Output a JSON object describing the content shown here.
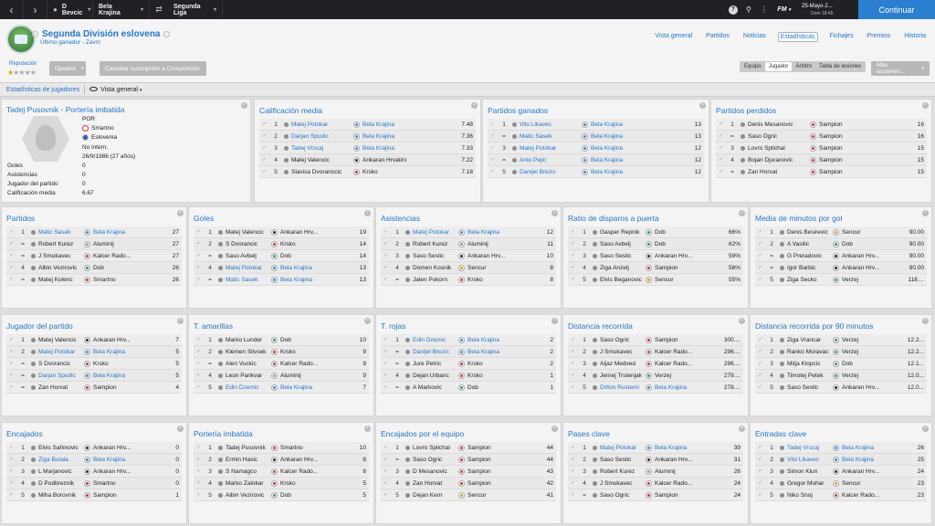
{
  "topbar": {
    "crumbs": [
      "D Bevcic",
      "Bela Krajina",
      "Segunda Liga"
    ],
    "fm_label": "FM",
    "date": "25-Mayo-2...",
    "time": "Dom 18:45",
    "continue_label": "Continuar"
  },
  "header": {
    "title": "Segunda División eslovena",
    "subtitle": "Último ganador - Zavrc",
    "tabs": [
      "Vista general",
      "Partidos",
      "Noticias",
      "Estadísticas",
      "Fichajes",
      "Premios",
      "Historia"
    ],
    "subtabs": [
      "Equipo",
      "Jugador",
      "Árbitro",
      "Tabla de lesiones"
    ],
    "reputation_label": "Reputación",
    "reputation_stars": 1,
    "scout_label": "Ojeador",
    "cancel_label": "Cancelar suscripción a Competición",
    "more_label": "Más acciones..."
  },
  "filter": {
    "link": "Estadísticas de jugadores",
    "view": "Vista general"
  },
  "player": {
    "title": "Tadej Pusovnik - Portería imbatida",
    "position": "POR",
    "club": "Smartno",
    "nation": "Eslovenia",
    "intl": "No intern.",
    "dob": "26/9/1986 (27 años)",
    "stats": [
      {
        "label": "Goles",
        "value": "0"
      },
      {
        "label": "Asistencias",
        "value": "0"
      },
      {
        "label": "Jugador del partido",
        "value": "0"
      },
      {
        "label": "Calificación media",
        "value": "6.67"
      }
    ]
  },
  "colors": {
    "accent": "#2577c8",
    "topbar": "#1f2124",
    "continue": "#2a7fd1"
  },
  "panels": [
    {
      "title": "Calificación media",
      "rows": [
        [
          "1",
          "Matej Potokar",
          "Bela Krajina",
          "7.48"
        ],
        [
          "2",
          "Darjan Spudic",
          "Bela Krajina",
          "7.36"
        ],
        [
          "3",
          "Tadej Vrscaj",
          "Bela Krajina",
          "7.33"
        ],
        [
          "4",
          "Matej Valencic",
          "Ankaran Hrvatini",
          "7.22"
        ],
        [
          "5",
          "Slavisa Dvoranocic",
          "Krsko",
          "7.18"
        ]
      ]
    },
    {
      "title": "Partidos ganados",
      "rows": [
        [
          "1",
          "Vito Likavec",
          "Bela Krajina",
          "13"
        ],
        [
          "=",
          "Matic Sasek",
          "Bela Krajina",
          "13"
        ],
        [
          "3",
          "Matej Potokar",
          "Bela Krajina",
          "12"
        ],
        [
          "=",
          "Anto Pejic",
          "Bela Krajina",
          "12"
        ],
        [
          "5",
          "Danijel Brezic",
          "Bela Krajina",
          "12"
        ]
      ]
    },
    {
      "title": "Partidos perdidos",
      "rows": [
        [
          "1",
          "Denis Mesanovic",
          "Sampion",
          "16"
        ],
        [
          "=",
          "Saso Ogric",
          "Sampion",
          "16"
        ],
        [
          "3",
          "Lovro Splichal",
          "Sampion",
          "15"
        ],
        [
          "4",
          "Bojan Djuranovic",
          "Sampion",
          "15"
        ],
        [
          "=",
          "Zan Horvat",
          "Sampion",
          "15"
        ]
      ]
    },
    {
      "title": "Partidos",
      "rows": [
        [
          "1",
          "Matic Sasek",
          "Bela Krajina",
          "27"
        ],
        [
          "=",
          "Robert Kurez",
          "Aluminij",
          "27"
        ],
        [
          "=",
          "J Smukavec",
          "Kalcer Rado...",
          "27"
        ],
        [
          "4",
          "Albin Vezirovic",
          "Dob",
          "26"
        ],
        [
          "=",
          "Matej Kolenc",
          "Smartno",
          "26"
        ]
      ]
    },
    {
      "title": "Goles",
      "rows": [
        [
          "1",
          "Matej Valencic",
          "Ankaran Hrv...",
          "19"
        ],
        [
          "2",
          "S Dvorancic",
          "Krsko",
          "14"
        ],
        [
          "=",
          "Saso Avbelj",
          "Dob",
          "14"
        ],
        [
          "4",
          "Matej Potokar",
          "Bela Krajina",
          "13"
        ],
        [
          "=",
          "Matic Sasek",
          "Bela Krajina",
          "13"
        ]
      ]
    },
    {
      "title": "Asistencias",
      "rows": [
        [
          "1",
          "Matej Potokar",
          "Bela Krajina",
          "12"
        ],
        [
          "2",
          "Robert Kurez",
          "Aluminij",
          "11"
        ],
        [
          "3",
          "Saso Sestic",
          "Ankaran Hrv...",
          "10"
        ],
        [
          "4",
          "Domen Kosnik",
          "Sencur",
          "8"
        ],
        [
          "=",
          "Jalen Pokorn",
          "Krsko",
          "8"
        ]
      ]
    },
    {
      "title": "Ratio de disparos a puerta",
      "rows": [
        [
          "1",
          "Gasper Repnik",
          "Dob",
          "66%"
        ],
        [
          "2",
          "Saso Avbelj",
          "Dob",
          "62%"
        ],
        [
          "3",
          "Saso Sestic",
          "Ankaran Hrv...",
          "59%"
        ],
        [
          "4",
          "Ziga Anzelj",
          "Sampion",
          "56%"
        ],
        [
          "5",
          "Elvis Beganovic",
          "Sencur",
          "55%"
        ]
      ]
    },
    {
      "title": "Media de minutos por gol",
      "rows": [
        [
          "1",
          "Denis Besirevic",
          "Sencur",
          "90.00"
        ],
        [
          "2",
          "A Vasilic",
          "Dob",
          "90.00"
        ],
        [
          "=",
          "G Preradovic",
          "Ankaran Hrv...",
          "90.00"
        ],
        [
          "=",
          "Igor Barbic",
          "Ankaran Hrv...",
          "90.00"
        ],
        [
          "5",
          "Ziga Secko",
          "Verzej",
          "118...."
        ]
      ]
    },
    {
      "title": "Jugador del partido",
      "rows": [
        [
          "1",
          "Matej Valencic",
          "Ankaran Hrv...",
          "7"
        ],
        [
          "2",
          "Matej Potokar",
          "Bela Krajina",
          "5"
        ],
        [
          "=",
          "S Dvorancic",
          "Krsko",
          "5"
        ],
        [
          "=",
          "Darjan Spudic",
          "Bela Krajina",
          "5"
        ],
        [
          "=",
          "Zan Horvat",
          "Sampion",
          "4"
        ]
      ]
    },
    {
      "title": "T. amarillas",
      "rows": [
        [
          "1",
          "Marko Lunder",
          "Dob",
          "10"
        ],
        [
          "2",
          "Klemen Slivsek",
          "Krsko",
          "9"
        ],
        [
          "=",
          "Alen Vuckic",
          "Kalcer Rado...",
          "9"
        ],
        [
          "4",
          "Leon Pankvar",
          "Aluminij",
          "9"
        ],
        [
          "5",
          "Edin Dzemic",
          "Bela Krajina",
          "7"
        ]
      ]
    },
    {
      "title": "T. rojas",
      "rows": [
        [
          "1",
          "Edin Dzemic",
          "Bela Krajina",
          "2"
        ],
        [
          "=",
          "Danijel Brezic",
          "Bela Krajina",
          "2"
        ],
        [
          "=",
          "Jure Petric",
          "Krsko",
          "2"
        ],
        [
          "4",
          "Dejan Urbanc",
          "Krsko",
          "1"
        ],
        [
          "=",
          "A Markovic",
          "Dob",
          "1"
        ]
      ]
    },
    {
      "title": "Distancia recorrida",
      "rows": [
        [
          "1",
          "Saso Ogric",
          "Sampion",
          "300...."
        ],
        [
          "2",
          "J Smukavec",
          "Kalcer Rado...",
          "296...."
        ],
        [
          "3",
          "Aljaz Medved",
          "Kalcer Rado...",
          "296...."
        ],
        [
          "4",
          "Jernej Trstenjak",
          "Verzej",
          "279...."
        ],
        [
          "5",
          "Driton Rustemi",
          "Bela Krajina",
          "278...."
        ]
      ]
    },
    {
      "title": "Distancia recorrida por 90 minutos",
      "rows": [
        [
          "1",
          "Ziga Vrancar",
          "Verzej",
          "12.2..."
        ],
        [
          "2",
          "Ranko Moravac",
          "Verzej",
          "12.2..."
        ],
        [
          "3",
          "Mitja Klopcic",
          "Dob",
          "12.1..."
        ],
        [
          "4",
          "Timotej Petek",
          "Verzej",
          "12.0..."
        ],
        [
          "5",
          "Saso Sestic",
          "Ankaran Hrv...",
          "12.0..."
        ]
      ]
    },
    {
      "title": "Encajados",
      "rows": [
        [
          "1",
          "Elvis Sahinovic",
          "Ankaran Hrv...",
          "0"
        ],
        [
          "2",
          "Ziga Butala",
          "Bela Krajina",
          "0"
        ],
        [
          "3",
          "L Marjanovic",
          "Ankaran Hrv...",
          "0"
        ],
        [
          "4",
          "D Podbreznik",
          "Smartno",
          "0"
        ],
        [
          "5",
          "Miha Borovnik",
          "Sampion",
          "1"
        ]
      ]
    },
    {
      "title": "Portería imbatida",
      "rows": [
        [
          "1",
          "Tadej Pusovnik",
          "Smartno",
          "10"
        ],
        [
          "2",
          "Ermin Hasic",
          "Ankaran Hrv...",
          "8"
        ],
        [
          "3",
          "S Namagco",
          "Kalcer Rado...",
          "8"
        ],
        [
          "4",
          "Marko Zalokar",
          "Krsko",
          "5"
        ],
        [
          "5",
          "Albin Vezirovic",
          "Dob",
          "5"
        ]
      ]
    },
    {
      "title": "Encajados por el equipo",
      "rows": [
        [
          "1",
          "Lovro Splichal",
          "Sampion",
          "44"
        ],
        [
          "=",
          "Saso Ogric",
          "Sampion",
          "44"
        ],
        [
          "3",
          "D Mesanovic",
          "Sampion",
          "43"
        ],
        [
          "4",
          "Zan Horvat",
          "Sampion",
          "42"
        ],
        [
          "5",
          "Dejan Kern",
          "Sencur",
          "41"
        ]
      ]
    },
    {
      "title": "Pases clave",
      "rows": [
        [
          "1",
          "Matej Potokar",
          "Bela Krajina",
          "39"
        ],
        [
          "2",
          "Saso Sestic",
          "Ankaran Hrv...",
          "31"
        ],
        [
          "3",
          "Robert Kurez",
          "Aluminij",
          "26"
        ],
        [
          "4",
          "J Smukavec",
          "Kalcer Rado...",
          "24"
        ],
        [
          "=",
          "Saso Ogric",
          "Sampion",
          "24"
        ]
      ]
    },
    {
      "title": "Entradas clave",
      "rows": [
        [
          "1",
          "Tadej Vrscaj",
          "Bela Krajina",
          "26"
        ],
        [
          "2",
          "Vito Likavec",
          "Bela Krajina",
          "25"
        ],
        [
          "3",
          "Simon Klun",
          "Ankaran Hrv...",
          "24"
        ],
        [
          "4",
          "Gregor Mohar",
          "Sencur",
          "23"
        ],
        [
          "5",
          "Niko Snoj",
          "Kalcer Rado...",
          "23"
        ]
      ]
    }
  ]
}
